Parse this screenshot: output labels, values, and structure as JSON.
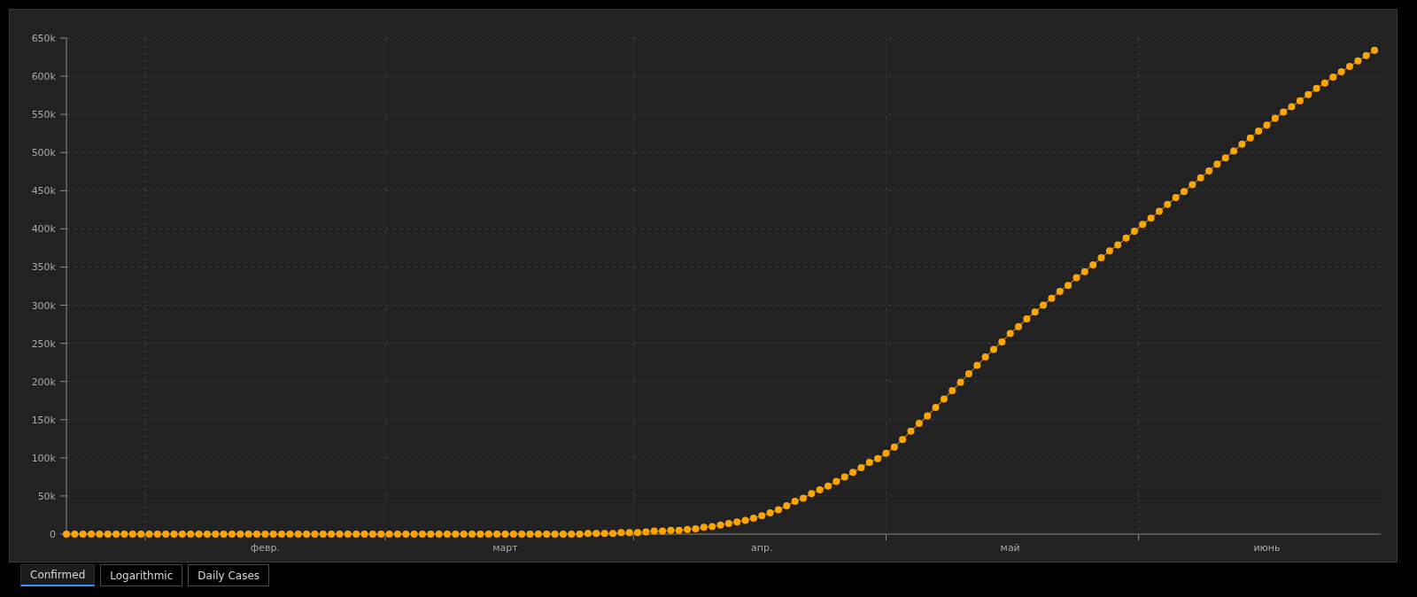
{
  "chart": {
    "chart_data": {
      "type": "line",
      "grid": true,
      "categories": [
        null,
        null,
        null,
        null,
        null,
        null,
        null,
        null,
        null,
        null,
        null,
        null,
        null,
        null,
        null,
        null,
        null,
        null,
        null,
        null,
        null,
        null,
        null,
        null,
        "февр.",
        null,
        null,
        null,
        null,
        null,
        null,
        null,
        null,
        null,
        null,
        null,
        null,
        null,
        null,
        null,
        null,
        null,
        null,
        null,
        null,
        null,
        null,
        null,
        null,
        null,
        null,
        null,
        null,
        "март",
        null,
        null,
        null,
        null,
        null,
        null,
        null,
        null,
        null,
        null,
        null,
        null,
        null,
        null,
        null,
        null,
        null,
        null,
        null,
        null,
        null,
        null,
        null,
        null,
        null,
        null,
        null,
        null,
        null,
        null,
        "апр.",
        null,
        null,
        null,
        null,
        null,
        null,
        null,
        null,
        null,
        null,
        null,
        null,
        null,
        null,
        null,
        null,
        null,
        null,
        null,
        null,
        null,
        null,
        null,
        null,
        null,
        null,
        null,
        null,
        null,
        "май",
        null,
        null,
        null,
        null,
        null,
        null,
        null,
        null,
        null,
        null,
        null,
        null,
        null,
        null,
        null,
        null,
        null,
        null,
        null,
        null,
        null,
        null,
        null,
        null,
        null,
        null,
        null,
        null,
        null,
        null,
        "июнь",
        null,
        null,
        null,
        null,
        null,
        null,
        null,
        null,
        null,
        null,
        null,
        null,
        null
      ],
      "series": [
        {
          "color": "#ffa500",
          "marker": "circle",
          "values": [
            0,
            0,
            0,
            0,
            0,
            0,
            0,
            0,
            0,
            0,
            0,
            0,
            0,
            0,
            0,
            0,
            0,
            0,
            0,
            0,
            0,
            0,
            0,
            0,
            0,
            0,
            0,
            0,
            0,
            0,
            0,
            0,
            0,
            0,
            0,
            0,
            0,
            0,
            0,
            0,
            0,
            0,
            0,
            0,
            0,
            0,
            0,
            0,
            0,
            0,
            0,
            0,
            0,
            0,
            0,
            0,
            0,
            0,
            0,
            0,
            0,
            0,
            0,
            1000,
            1000,
            1000,
            1000,
            2000,
            2000,
            2000,
            3000,
            4000,
            4000,
            5000,
            5000,
            6000,
            7000,
            9000,
            10000,
            12000,
            14000,
            16000,
            18000,
            21000,
            24000,
            28000,
            32000,
            37000,
            43000,
            47000,
            53000,
            58000,
            63000,
            69000,
            75000,
            81000,
            87000,
            94000,
            99000,
            106000,
            114000,
            124000,
            135000,
            145000,
            155000,
            166000,
            177000,
            188000,
            199000,
            210000,
            221000,
            232000,
            242000,
            252000,
            263000,
            272000,
            282000,
            291000,
            300000,
            309000,
            318000,
            326000,
            336000,
            344000,
            353000,
            362000,
            371000,
            379000,
            388000,
            397000,
            406000,
            414000,
            423000,
            432000,
            441000,
            449000,
            458000,
            467000,
            476000,
            485000,
            493000,
            502000,
            511000,
            519000,
            528000,
            536000,
            545000,
            553000,
            560000,
            568000,
            576000,
            584000,
            591000,
            599000,
            606000,
            613000,
            620000,
            627000,
            634000
          ]
        }
      ],
      "ylim": [
        0,
        650000
      ],
      "yticks": [
        {
          "value": 0,
          "label": "0"
        },
        {
          "value": 50000,
          "label": "50k"
        },
        {
          "value": 100000,
          "label": "100k"
        },
        {
          "value": 150000,
          "label": "150k"
        },
        {
          "value": 200000,
          "label": "200k"
        },
        {
          "value": 250000,
          "label": "250k"
        },
        {
          "value": 300000,
          "label": "300k"
        },
        {
          "value": 350000,
          "label": "350k"
        },
        {
          "value": 400000,
          "label": "400k"
        },
        {
          "value": 450000,
          "label": "450k"
        },
        {
          "value": 500000,
          "label": "500k"
        },
        {
          "value": 550000,
          "label": "550k"
        },
        {
          "value": 600000,
          "label": "600k"
        },
        {
          "value": 650000,
          "label": "650k"
        }
      ]
    }
  },
  "tabs": [
    {
      "label": "Confirmed",
      "selected": true
    },
    {
      "label": "Logarithmic",
      "selected": false
    },
    {
      "label": "Daily Cases",
      "selected": false
    }
  ]
}
